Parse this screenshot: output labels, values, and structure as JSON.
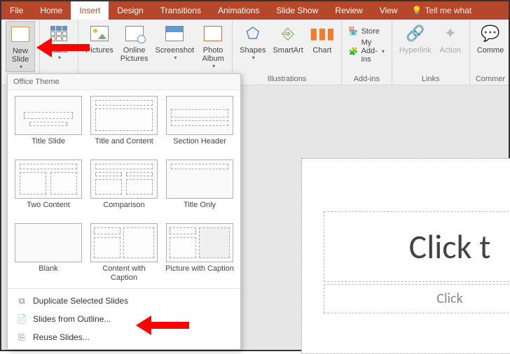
{
  "tabs": {
    "file": "File",
    "home": "Home",
    "insert": "Insert",
    "design": "Design",
    "transitions": "Transitions",
    "animations": "Animations",
    "slideshow": "Slide Show",
    "review": "Review",
    "view": "View",
    "tellme": "Tell me what"
  },
  "ribbon": {
    "newSlide": "New\nSlide",
    "table": "Table",
    "pictures": "Pictures",
    "onlinePictures": "Online\nPictures",
    "screenshot": "Screenshot",
    "photoAlbum": "Photo\nAlbum",
    "shapes": "Shapes",
    "smartart": "SmartArt",
    "chart": "Chart",
    "store": "Store",
    "myAddins": "My Add-ins",
    "hyperlink": "Hyperlink",
    "action": "Action",
    "comment": "Comme",
    "groups": {
      "illustrations": "Illustrations",
      "addins": "Add-ins",
      "links": "Links",
      "comments": "Commer"
    }
  },
  "gallery": {
    "header": "Office Theme",
    "layouts": [
      "Title Slide",
      "Title and Content",
      "Section Header",
      "Two Content",
      "Comparison",
      "Title Only",
      "Blank",
      "Content with Caption",
      "Picture with Caption"
    ],
    "footer": {
      "duplicate": "Duplicate Selected Slides",
      "outline": "Slides from Outline...",
      "reuse": "Reuse Slides..."
    }
  },
  "slide": {
    "title": "Click t",
    "subtitle": "Click"
  }
}
